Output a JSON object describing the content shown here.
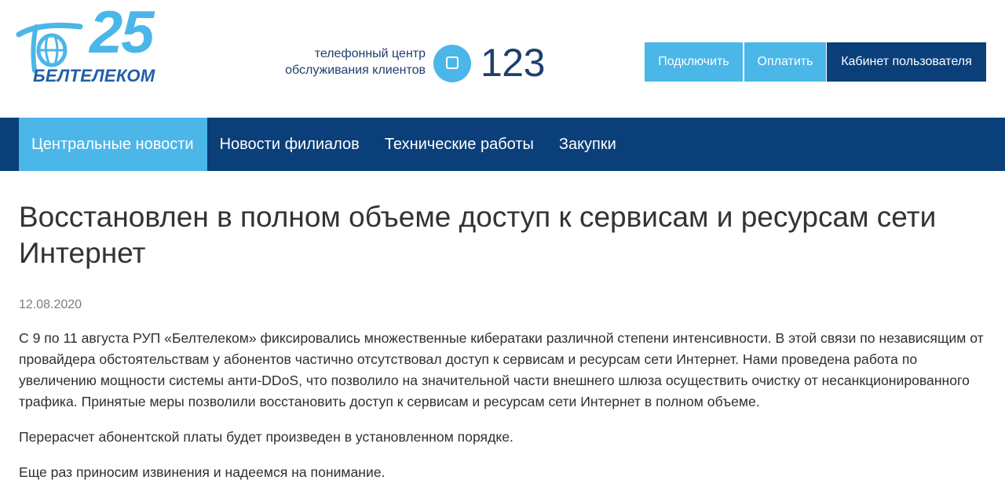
{
  "brand": {
    "name": "БЕЛТЕЛЕКОМ",
    "anniversary": "25",
    "colors": {
      "light_blue": "#4bb6e8",
      "dark_blue": "#0a3f7a",
      "logo_blue": "#1f5fa8"
    }
  },
  "header": {
    "phone_caption_line1": "телефонный центр",
    "phone_caption_line2": "обслуживания клиентов",
    "phone_icon": "phone-square-icon",
    "phone_number": "123",
    "buttons": {
      "connect": "Подключить",
      "pay": "Оплатить",
      "cabinet": "Кабинет пользователя"
    }
  },
  "nav": {
    "items": [
      {
        "label": "Центральные новости",
        "active": true
      },
      {
        "label": "Новости филиалов",
        "active": false
      },
      {
        "label": "Технические работы",
        "active": false
      },
      {
        "label": "Закупки",
        "active": false
      }
    ]
  },
  "article": {
    "title": "Восстановлен в полном объеме доступ к сервисам и ресурсам сети Интернет",
    "date": "12.08.2020",
    "paragraphs": [
      "С 9 по 11 августа РУП «Белтелеком» фиксировались множественные кибератаки различной степени интенсивности. В этой связи по независящим от провайдера обстоятельствам у абонентов частично отсутствовал доступ к сервисам и ресурсам сети Интернет. Нами проведена работа по увеличению мощности системы анти-DDoS, что позволило на значительной части внешнего шлюза осуществить очистку от несанкционированного трафика. Принятые меры позволили восстановить доступ к сервисам и ресурсам сети Интернет в полном объеме.",
      "Перерасчет абонентской платы будет произведен в установленном порядке.",
      "Еще раз приносим извинения и надеемся на понимание."
    ]
  }
}
